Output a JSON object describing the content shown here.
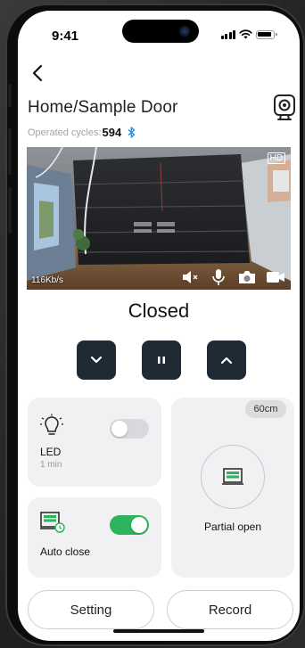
{
  "status_bar": {
    "time": "9:41"
  },
  "header": {
    "title": "Home/Sample Door",
    "cycles_label": "Operated cycles:",
    "cycles_value": "594"
  },
  "video": {
    "bitrate": "116Kb/s",
    "quality": "HD",
    "controls": [
      "speaker-muted-icon",
      "microphone-icon",
      "snapshot-camera-icon",
      "record-video-icon"
    ]
  },
  "door": {
    "state": "Closed",
    "controls": [
      "chevron-down-icon",
      "pause-icon",
      "chevron-up-icon"
    ]
  },
  "led": {
    "label": "LED",
    "sublabel": "1 min",
    "enabled": false
  },
  "auto_close": {
    "label": "Auto close",
    "enabled": true
  },
  "partial_open": {
    "height": "60cm",
    "label": "Partial open"
  },
  "footer": {
    "setting_label": "Setting",
    "record_label": "Record"
  },
  "colors": {
    "accent_green": "#2db55d",
    "control_dark": "#1f2a35",
    "bluetooth_blue": "#1f8ef1",
    "card_bg": "#f1f1f3"
  }
}
